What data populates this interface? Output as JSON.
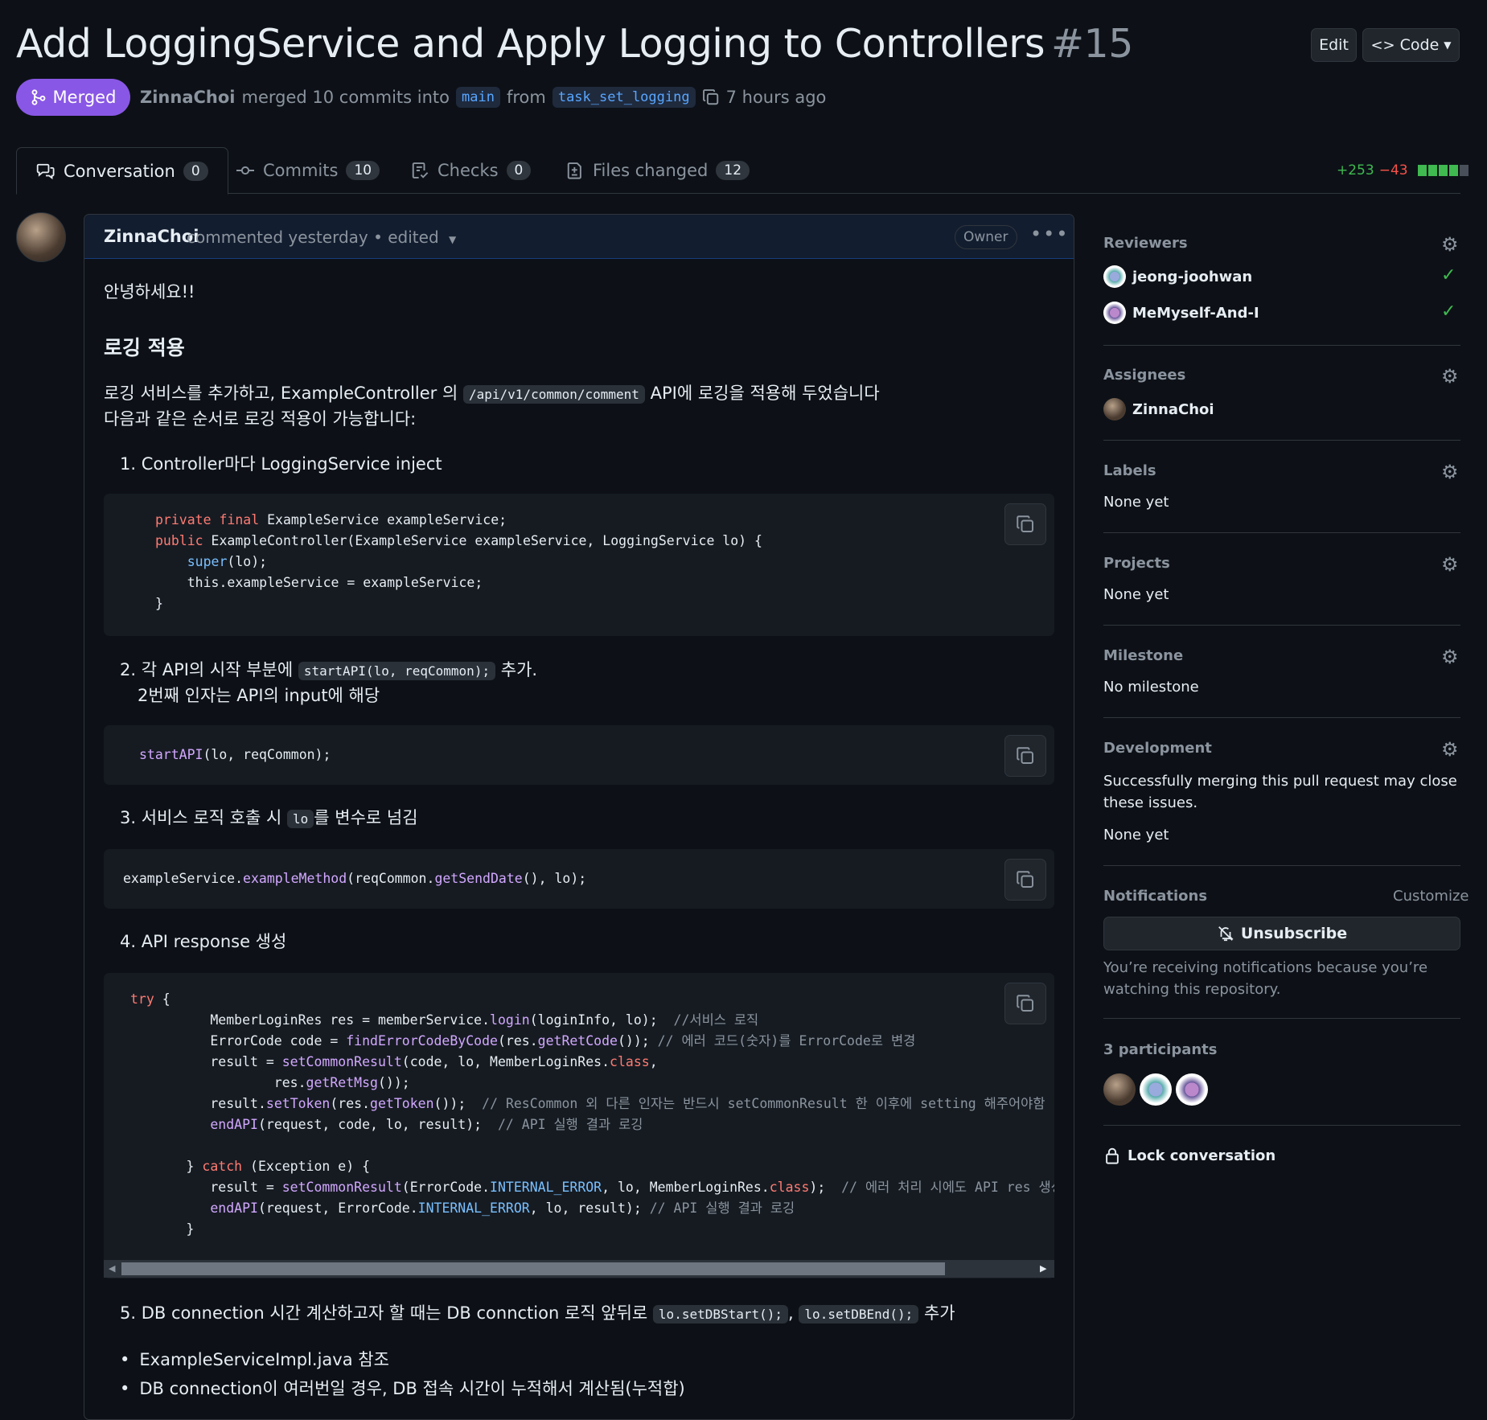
{
  "header": {
    "title": "Add LoggingService and Apply Logging to Controllers",
    "number": "#15",
    "edit_label": "Edit",
    "code_label": "Code",
    "status": "Merged",
    "author": "ZinnaChoi",
    "merge_text": "merged 10 commits into",
    "base_branch": "main",
    "from_text": "from",
    "head_branch": "task_set_logging",
    "time": "7 hours ago"
  },
  "tabs": [
    {
      "label": "Conversation",
      "count": "0",
      "icon": "comment-discussion-icon"
    },
    {
      "label": "Commits",
      "count": "10",
      "icon": "git-commit-icon"
    },
    {
      "label": "Checks",
      "count": "0",
      "icon": "checklist-icon"
    },
    {
      "label": "Files changed",
      "count": "12",
      "icon": "file-diff-icon"
    }
  ],
  "diffstat": {
    "additions": "+253",
    "deletions": "−43"
  },
  "comment": {
    "author": "ZinnaChoi",
    "meta": "commented yesterday • edited",
    "role": "Owner",
    "greeting": "안녕하세요!!",
    "heading": "로깅 적용",
    "intro_1a": "로깅 서비스를 추가하고, ExampleController 의",
    "intro_1_code": "/api/v1/common/comment",
    "intro_1b": "API에 로깅을 적용해 두었습니다",
    "intro_2": "다음과 같은 순서로 로깅 적용이 가능합니다:",
    "step1": "1. Controller마다 LoggingService inject",
    "step2a": "2. 각 API의 시작 부분에",
    "step2_code": "startAPI(lo, reqCommon);",
    "step2b": "추가.",
    "step2_line2": "2번째 인자는 API의 input에 해당",
    "step3a": "3. 서비스 로직 호출 시",
    "step3_code": "lo",
    "step3b": "를 변수로 넘김",
    "step4": "4. API response 생성",
    "step5a": "5. DB connection 시간 계산하고자 할 때는 DB connction 로직 앞뒤로",
    "step5_code1": "lo.setDBStart();",
    "step5_sep": ",",
    "step5_code2": "lo.setDBEnd();",
    "step5b": "추가",
    "bullet1": "ExampleServiceImpl.java 참조",
    "bullet2": "DB connection이 여러번일 경우, DB 접속 시간이 누적해서 계산됨(누적합)"
  },
  "code": {
    "block1": [
      "private final ExampleService exampleService;",
      "public ExampleController(ExampleService exampleService, LoggingService lo) {",
      "    super(lo);",
      "    this.exampleService = exampleService;",
      "}"
    ],
    "block2": [
      "startAPI(lo, reqCommon);"
    ],
    "block3": [
      "exampleService.exampleMethod(reqCommon.getSendDate(), lo);"
    ],
    "block4": [
      "try {",
      "        MemberLoginRes res = memberService.login(loginInfo, lo);  //서비스 로직",
      "        ErrorCode code = findErrorCodeByCode(res.getRetCode()); // 에러 코드(숫자)를 ErrorCode로 변경",
      "        result = setCommonResult(code, lo, MemberLoginRes.class,",
      "                res.getRetMsg());",
      "        result.setToken(res.getToken());  // ResCommon 외 다른 인자는 반드시 setCommonResult 한 이후에 setting 해주어야함",
      "        endAPI(request, code, lo, result);  // API 실행 결과 로깅",
      "",
      "    } catch (Exception e) {",
      "        result = setCommonResult(ErrorCode.INTERNAL_ERROR, lo, MemberLoginRes.class);  // 에러 처리 시에도 API res 생성",
      "        endAPI(request, ErrorCode.INTERNAL_ERROR, lo, result); // API 실행 결과 로깅",
      "    }"
    ]
  },
  "sidebar": {
    "reviewers_title": "Reviewers",
    "reviewers": [
      "jeong-joohwan",
      "MeMyself-And-I"
    ],
    "assignees_title": "Assignees",
    "assignee": "ZinnaChoi",
    "labels_title": "Labels",
    "labels_value": "None yet",
    "projects_title": "Projects",
    "projects_value": "None yet",
    "milestone_title": "Milestone",
    "milestone_value": "No milestone",
    "development_title": "Development",
    "development_text": "Successfully merging this pull request may close these issues.",
    "development_value": "None yet",
    "notifications_title": "Notifications",
    "customize_label": "Customize",
    "unsubscribe_label": "Unsubscribe",
    "notifications_text": "You’re receiving notifications because you’re watching this repository.",
    "participants_title": "3 participants",
    "lock_label": "Lock conversation"
  },
  "colors": {
    "background": "#0d1117",
    "merged": "#8957e5",
    "link": "#58a6ff",
    "addition": "#3fb950",
    "deletion": "#f85149"
  }
}
